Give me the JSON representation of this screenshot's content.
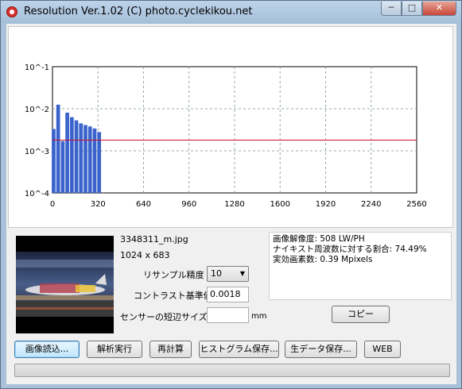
{
  "window": {
    "title": "Resolution Ver.1.02 (C) photo.cyclekikou.net",
    "minimize_glyph": "─",
    "maximize_glyph": "□",
    "close_glyph": "✕",
    "icon": "app-icon"
  },
  "chart_data": {
    "type": "bar",
    "xlim": [
      0,
      2560
    ],
    "xticks": [
      0,
      320,
      640,
      960,
      1280,
      1600,
      1920,
      2240,
      2560
    ],
    "ylog": true,
    "ylim": [
      0.0001,
      0.1
    ],
    "ytick_labels": [
      "10^-1",
      "10^-2",
      "10^-3",
      "10^-4"
    ],
    "yticks": [
      0.1,
      0.01,
      0.001,
      0.0001
    ],
    "x": [
      8,
      40,
      72,
      104,
      136,
      168,
      200,
      232,
      264,
      296,
      328
    ],
    "values": [
      0.0033,
      0.0125,
      0.0017,
      0.0081,
      0.0063,
      0.0053,
      0.0045,
      0.0041,
      0.0038,
      0.0034,
      0.0028
    ],
    "threshold": 0.0018,
    "colors": {
      "bars": "#3a63cc",
      "threshold": "#d0102a",
      "grid": "#9aa8a8"
    },
    "grid": true
  },
  "file": {
    "name": "3348311_m.jpg",
    "dimensions": "1024 x 683"
  },
  "settings": {
    "resample_label": "リサンプル精度",
    "resample_value": "10",
    "contrast_label": "コントラスト基準値",
    "contrast_value": "0.0018",
    "sensor_label": "センサーの短辺サイズ",
    "sensor_value": "",
    "sensor_unit": "mm"
  },
  "results": {
    "lines": [
      "画像解像度: 508 LW/PH",
      "ナイキスト周波数に対する割合: 74.49%",
      "実効画素数: 0.39 Mpixels"
    ]
  },
  "buttons": {
    "copy": "コピー",
    "load": "画像読込...",
    "analyze": "解析実行",
    "recalc": "再計算",
    "save_hist": "ヒストグラム保存...",
    "save_raw": "生データ保存...",
    "web": "WEB"
  },
  "progress": 0
}
